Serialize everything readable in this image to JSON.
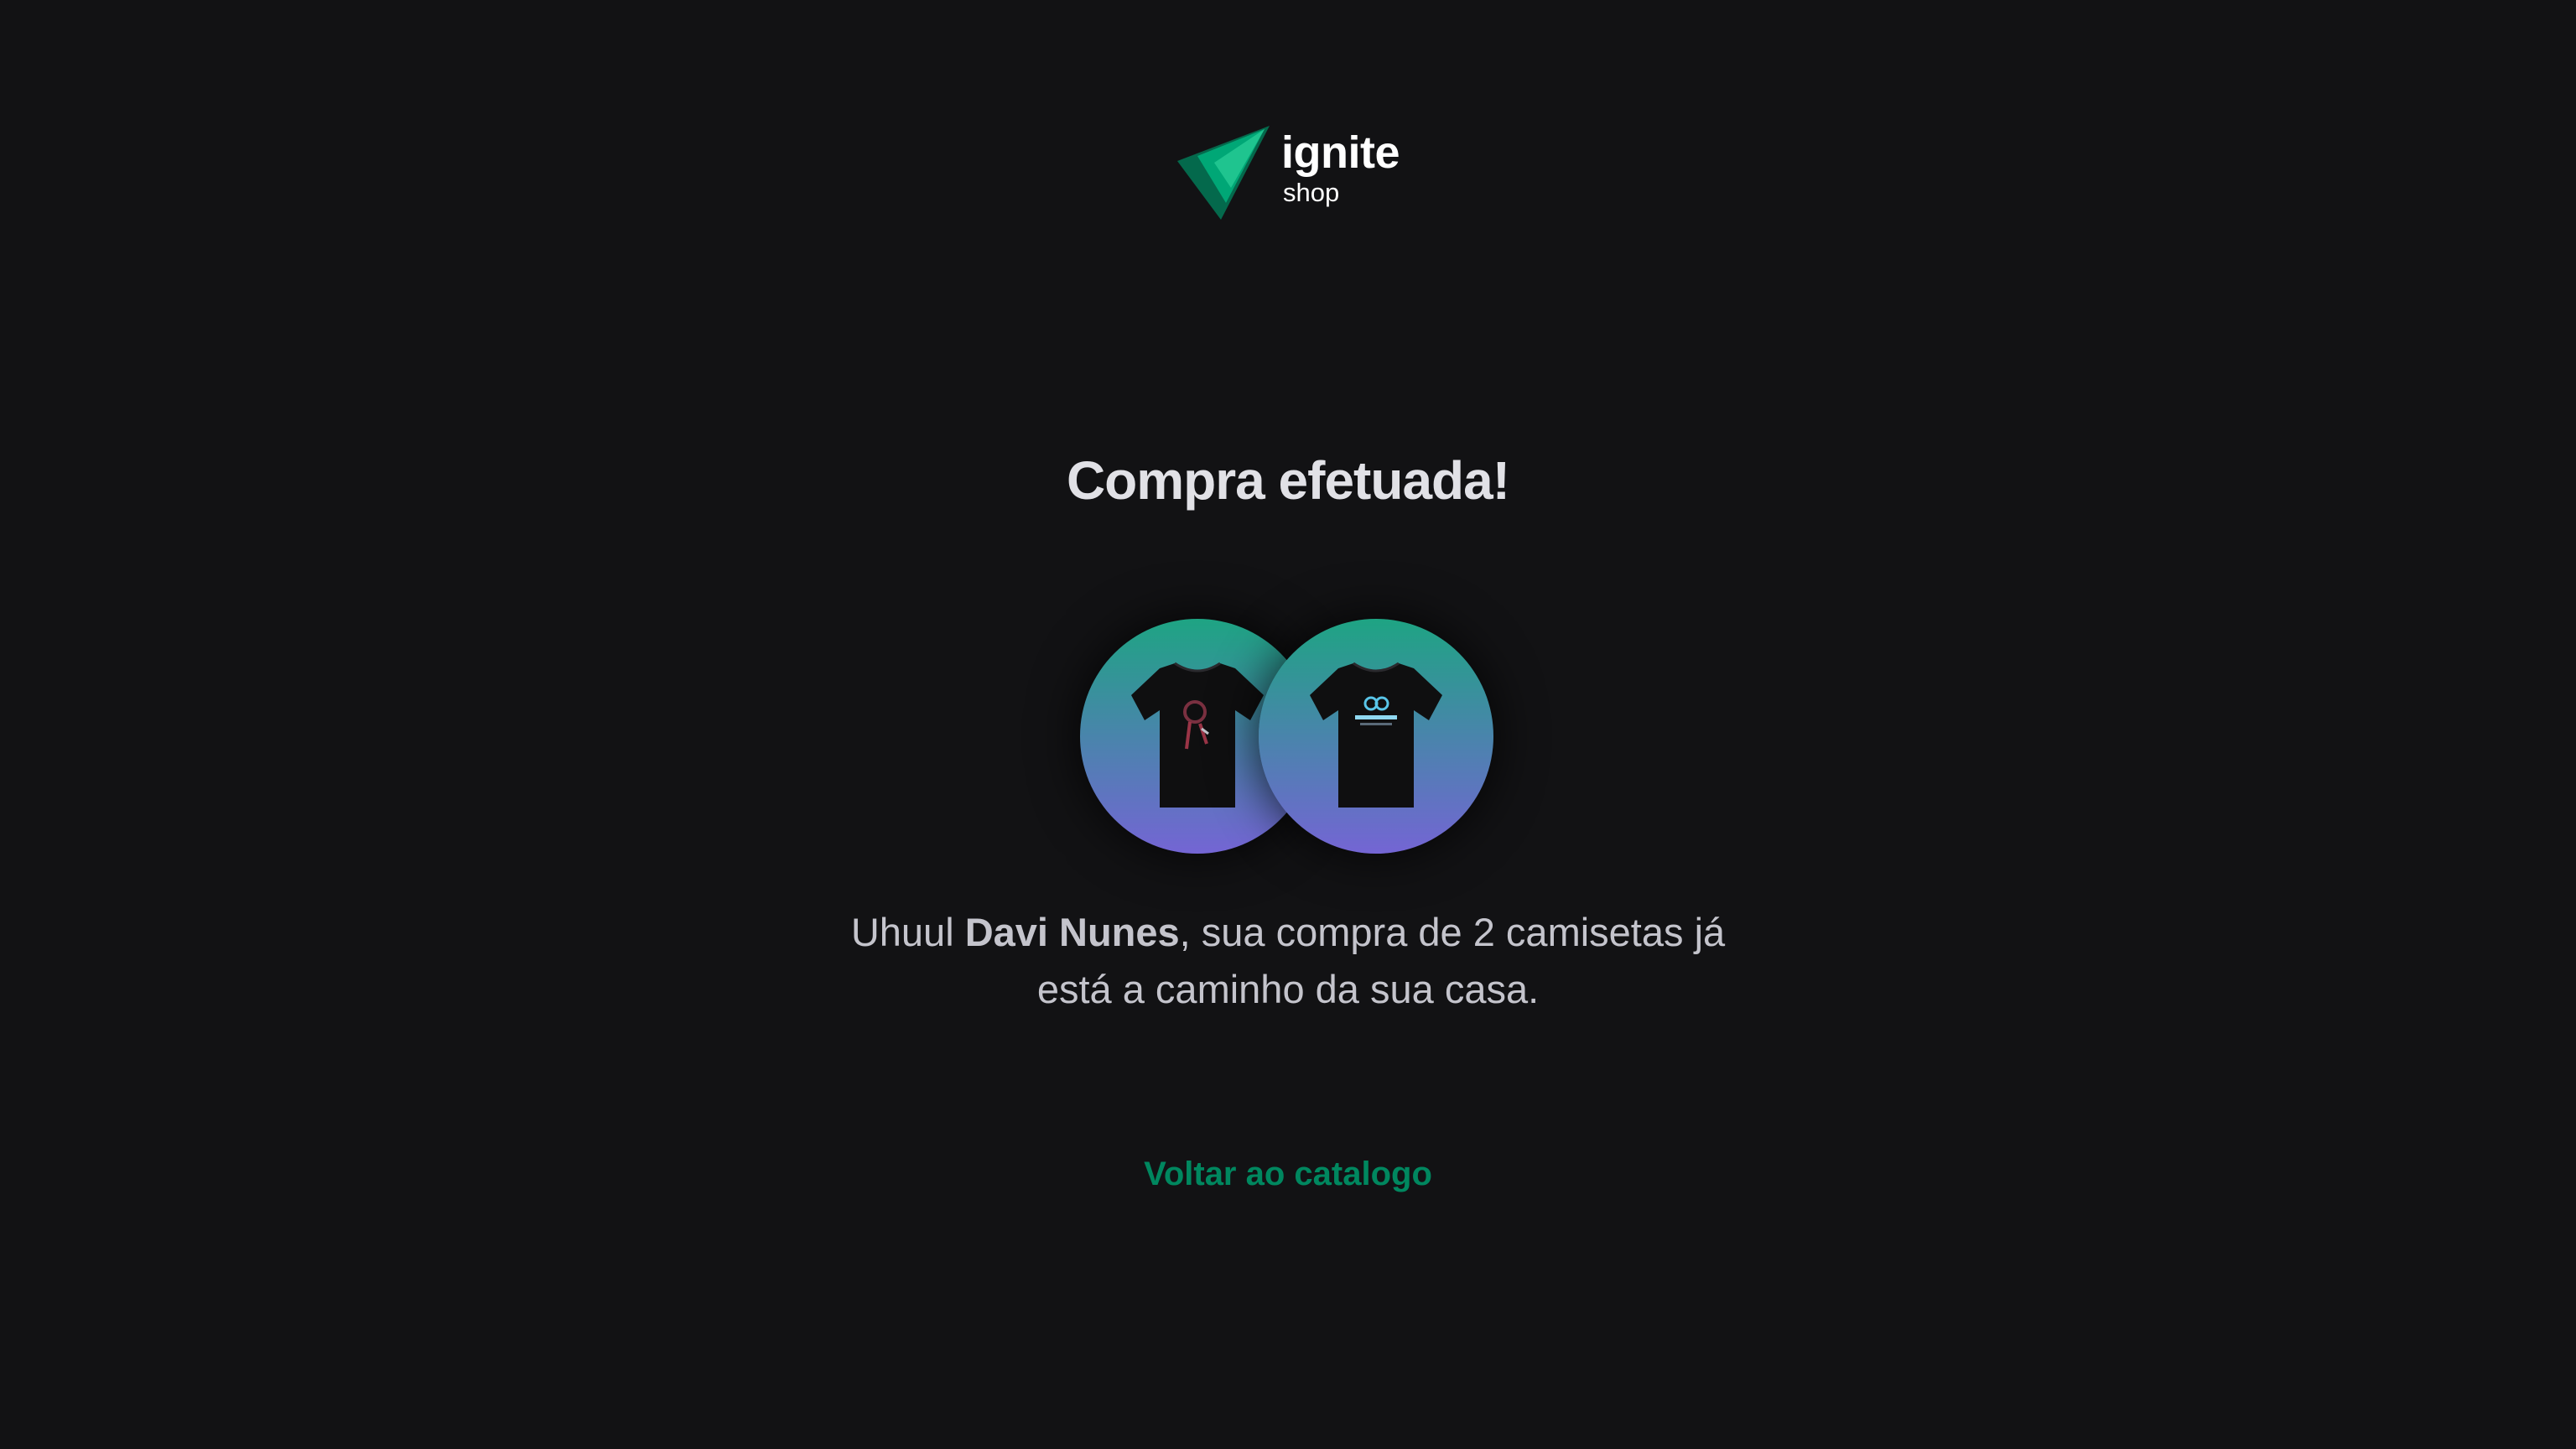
{
  "header": {
    "logo_title": "ignite",
    "logo_subtitle": "shop",
    "logo_icon": "ignite-triangle-logo-icon"
  },
  "main": {
    "title": "Compra efetuada!",
    "products": [
      {
        "icon": "tshirt-image-icon",
        "alt": "camiseta"
      },
      {
        "icon": "tshirt-image-icon",
        "alt": "camiseta"
      }
    ],
    "message": {
      "prefix": "Uhuul ",
      "customer_name": "Davi Nunes",
      "line1_suffix": ", sua compra de 2 camisetas já",
      "line2": "está a caminho da sua casa."
    },
    "back_link_label": "Voltar ao catalogo"
  },
  "colors": {
    "background": "#121214",
    "title": "#e1e1e6",
    "text": "#c4c4cc",
    "link": "#00875f",
    "gradient_start": "#1ea483",
    "gradient_end": "#7465d4"
  }
}
